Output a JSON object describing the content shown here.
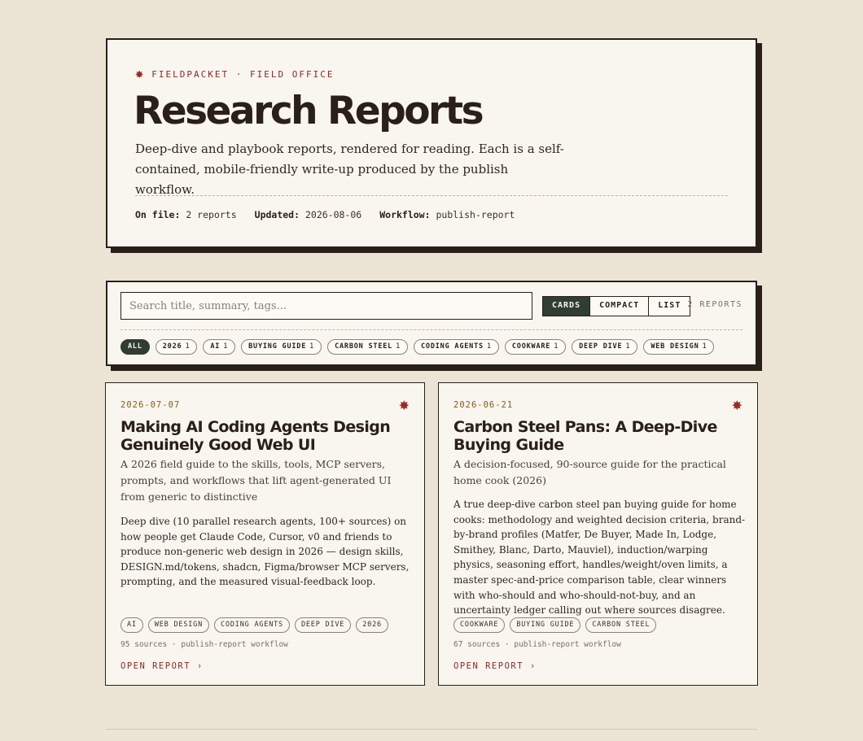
{
  "header": {
    "eyebrow": "FIELDPACKET · FIELD OFFICE",
    "title": "Research Reports",
    "lede": "Deep-dive and playbook reports, rendered for reading. Each is a self-contained, mobile-friendly write-up produced by the publish workflow.",
    "meta": [
      {
        "label": "On file:",
        "value": "2 reports"
      },
      {
        "label": "Updated:",
        "value": "2026-08-06"
      },
      {
        "label": "Workflow:",
        "value": "publish-report"
      }
    ]
  },
  "filter": {
    "search_placeholder": "Search title, summary, tags...",
    "views": [
      "CARDS",
      "COMPACT",
      "LIST"
    ],
    "active_view": "CARDS",
    "count": "2 REPORTS",
    "chips": [
      {
        "label": "ALL",
        "count": ""
      },
      {
        "label": "2026",
        "count": "1"
      },
      {
        "label": "AI",
        "count": "1"
      },
      {
        "label": "BUYING GUIDE",
        "count": "1"
      },
      {
        "label": "CARBON STEEL",
        "count": "1"
      },
      {
        "label": "CODING AGENTS",
        "count": "1"
      },
      {
        "label": "COOKWARE",
        "count": "1"
      },
      {
        "label": "DEEP DIVE",
        "count": "1"
      },
      {
        "label": "WEB DESIGN",
        "count": "1"
      }
    ]
  },
  "reports": [
    {
      "date": "2026-07-07",
      "title": "Making AI Coding Agents Design Genuinely Good Web UI",
      "subtitle": "A 2026 field guide to the skills, tools, MCP servers, prompts, and workflows that lift agent-generated UI from generic to distinctive",
      "description": "Deep dive (10 parallel research agents, 100+ sources) on how people get Claude Code, Cursor, v0 and friends to produce non-generic web design in 2026 — design skills, DESIGN.md/tokens, shadcn, Figma/browser MCP servers, prompting, and the measured visual-feedback loop.",
      "tags": [
        "AI",
        "WEB DESIGN",
        "CODING AGENTS",
        "DEEP DIVE",
        "2026"
      ],
      "footer": "95 sources · publish-report workflow",
      "link": "OPEN REPORT ›"
    },
    {
      "date": "2026-06-21",
      "title": "Carbon Steel Pans: A Deep-Dive Buying Guide",
      "subtitle": "A decision-focused, 90-source guide for the practical home cook (2026)",
      "description": "A true deep-dive carbon steel pan buying guide for home cooks: methodology and weighted decision criteria, brand-by-brand profiles (Matfer, De Buyer, Made In, Lodge, Smithey, Blanc, Darto, Mauviel), induction/warping physics, seasoning effort, handles/weight/oven limits, a master spec-and-price comparison table, clear winners with who-should and who-should-not-buy, and an uncertainty ledger calling out where sources disagree.",
      "tags": [
        "COOKWARE",
        "BUYING GUIDE",
        "CARBON STEEL"
      ],
      "footer": "67 sources · publish-report workflow",
      "link": "OPEN REPORT ›"
    }
  ],
  "colors": {
    "background": "#ece4d4",
    "panel": "#f9f6ef",
    "ink": "#2a2019",
    "accent_red": "#9c2b25",
    "active_green": "#2f3d33",
    "date_amber": "#8a5a1a"
  }
}
